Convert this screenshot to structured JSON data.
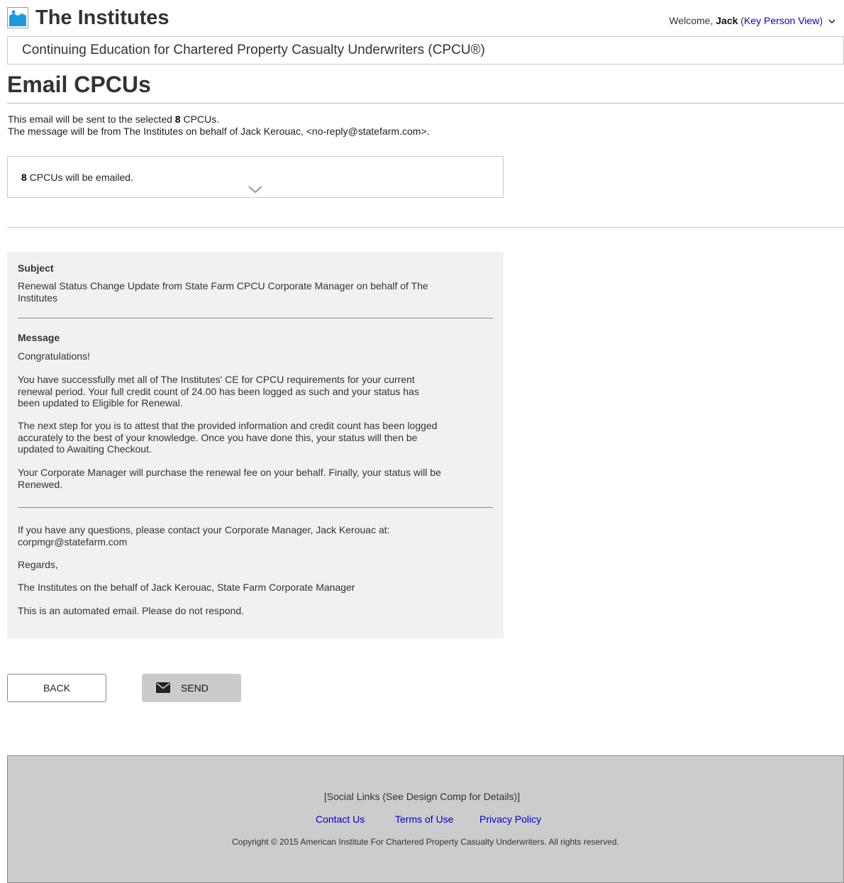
{
  "header": {
    "brand": "The Institutes",
    "welcome_prefix": "Welcome, ",
    "user_name": "Jack",
    "open_paren": " (",
    "view_link": "Key Person View",
    "close_paren": ")",
    "program_title": "Continuing Education for Chartered Property Casualty Underwriters (CPCU®)"
  },
  "page": {
    "title": "Email CPCUs",
    "intro_prefix": "This email will be sent to the selected ",
    "selected_count": "8",
    "intro_suffix": " CPCUs.",
    "from_line": "The message will be from The Institutes on behalf of Jack Kerouac, <no-reply@statefarm.com>."
  },
  "recipients": {
    "count": "8",
    "summary": " CPCUs will be emailed."
  },
  "email": {
    "subject_label": "Subject",
    "subject_text": "Renewal Status Change Update from State Farm CPCU Corporate Manager on behalf of The Institutes",
    "message_label": "Message",
    "greeting": "Congratulations!",
    "para1": "You have successfully met all of The Institutes' CE for CPCU requirements for your current renewal period. Your full credit count of 24.00 has been logged as such and your status has been updated to Eligible for Renewal.",
    "para2": "The next step for you is to attest that the provided information and credit count has been logged accurately to the best of your knowledge. Once you have done this, your status will then be updated to Awaiting Checkout.",
    "para3": "Your Corporate Manager will purchase the renewal fee on your behalf. Finally, your status will be Renewed.",
    "contact": "If you have any questions, please contact your Corporate Manager, Jack Kerouac at: corpmgr@statefarm.com",
    "regards": "Regards,",
    "signature": "The Institutes on the behalf of Jack Kerouac, State Farm Corporate Manager",
    "automated": "This is an automated email. Please do not respond."
  },
  "actions": {
    "back_label": "BACK",
    "send_label": "SEND",
    "send_icon": "envelope-icon"
  },
  "footer": {
    "social": "[Social Links (See Design Comp for Details)]",
    "links": [
      "Contact Us",
      "Terms of Use",
      "Privacy Policy"
    ],
    "copyright": "Copyright © 2015 American Institute For Chartered Property Casualty Underwriters. All rights reserved."
  },
  "colors": {
    "link": "#0000cc",
    "logo_blue": "#1a9be0",
    "panel_bg": "#f1f1f1",
    "footer_bg": "#cccccc",
    "send_bg": "#cbcbcb"
  }
}
